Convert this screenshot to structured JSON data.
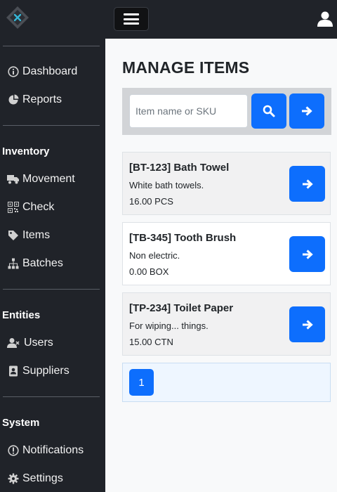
{
  "sidebar": {
    "items": [
      {
        "label": "Dashboard",
        "icon": "info-circle-icon"
      },
      {
        "label": "Reports",
        "icon": "pie-chart-icon"
      },
      {
        "label": "Movement",
        "icon": "truck-icon"
      },
      {
        "label": "Check",
        "icon": "qr-code-icon"
      },
      {
        "label": "Items",
        "icon": "tag-icon"
      },
      {
        "label": "Batches",
        "icon": "sitemap-icon"
      },
      {
        "label": "Users",
        "icon": "users-icon"
      },
      {
        "label": "Suppliers",
        "icon": "contact-book-icon"
      },
      {
        "label": "Notifications",
        "icon": "exclamation-circle-icon"
      },
      {
        "label": "Settings",
        "icon": "gear-icon"
      }
    ],
    "sections": {
      "inventory": "Inventory",
      "entities": "Entities",
      "system": "System"
    }
  },
  "main": {
    "title": "MANAGE ITEMS",
    "search": {
      "placeholder": "Item name or SKU",
      "value": ""
    },
    "items": [
      {
        "title": "[BT-123] Bath Towel",
        "description": "White bath towels.",
        "quantity": "16.00 PCS"
      },
      {
        "title": "[TB-345] Tooth Brush",
        "description": "Non electric.",
        "quantity": "0.00 BOX"
      },
      {
        "title": "[TP-234] Toilet Paper",
        "description": "For wiping... things.",
        "quantity": "15.00 CTN"
      }
    ],
    "pagination": {
      "current_page": "1"
    }
  },
  "colors": {
    "sidebar_bg": "#202329",
    "primary": "#0d6efd",
    "content_bg": "#f8f9fa"
  }
}
